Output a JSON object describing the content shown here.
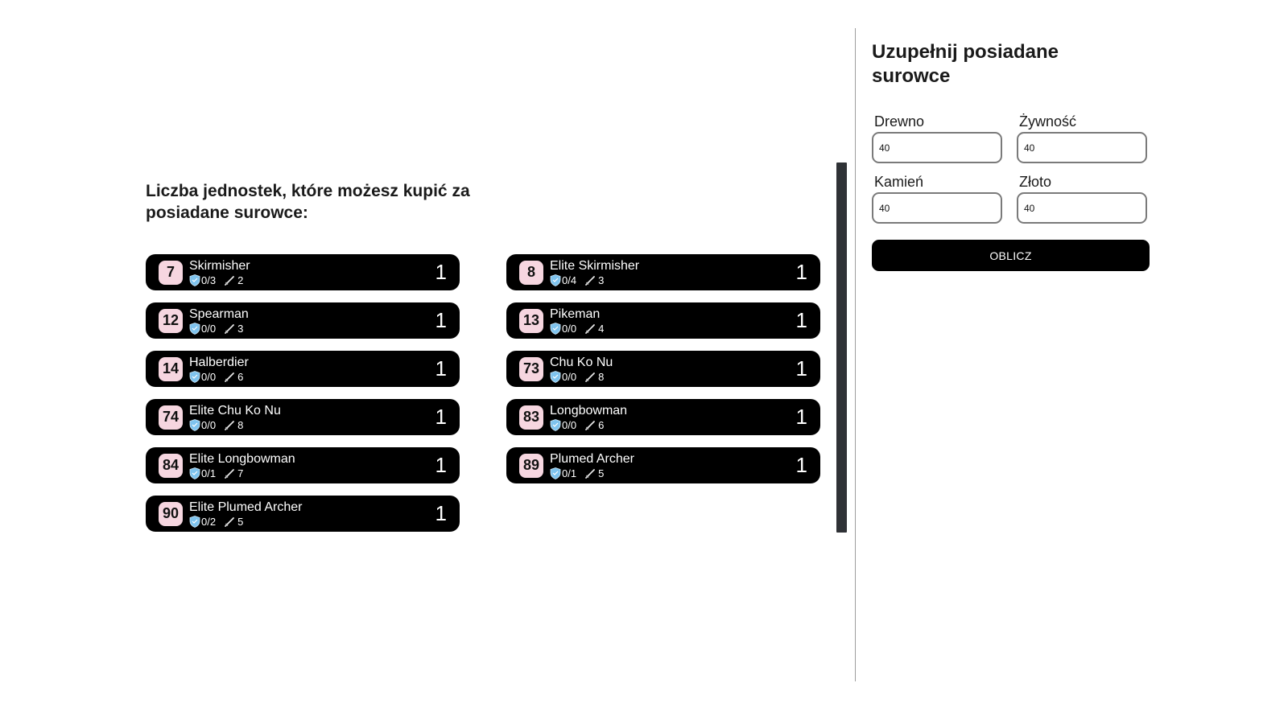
{
  "results": {
    "title": "Liczba jednostek, które możesz kupić za posiadane surowce:",
    "units": [
      {
        "id": "7",
        "name": "Skirmisher",
        "defense": "0/3",
        "attack": "2",
        "count": "1"
      },
      {
        "id": "8",
        "name": "Elite Skirmisher",
        "defense": "0/4",
        "attack": "3",
        "count": "1"
      },
      {
        "id": "12",
        "name": "Spearman",
        "defense": "0/0",
        "attack": "3",
        "count": "1"
      },
      {
        "id": "13",
        "name": "Pikeman",
        "defense": "0/0",
        "attack": "4",
        "count": "1"
      },
      {
        "id": "14",
        "name": "Halberdier",
        "defense": "0/0",
        "attack": "6",
        "count": "1"
      },
      {
        "id": "73",
        "name": "Chu Ko Nu",
        "defense": "0/0",
        "attack": "8",
        "count": "1"
      },
      {
        "id": "74",
        "name": "Elite Chu Ko Nu",
        "defense": "0/0",
        "attack": "8",
        "count": "1"
      },
      {
        "id": "83",
        "name": "Longbowman",
        "defense": "0/0",
        "attack": "6",
        "count": "1"
      },
      {
        "id": "84",
        "name": "Elite Longbowman",
        "defense": "0/1",
        "attack": "7",
        "count": "1"
      },
      {
        "id": "89",
        "name": "Plumed Archer",
        "defense": "0/1",
        "attack": "5",
        "count": "1"
      },
      {
        "id": "90",
        "name": "Elite Plumed Archer",
        "defense": "0/2",
        "attack": "5",
        "count": "1"
      }
    ],
    "icons": {
      "defense": "shield-icon",
      "attack": "sword-icon"
    }
  },
  "form": {
    "title": "Uzupełnij posiadane surowce",
    "fields": {
      "wood": {
        "label": "Drewno",
        "value": "40"
      },
      "food": {
        "label": "Żywność",
        "value": "40"
      },
      "stone": {
        "label": "Kamień",
        "value": "40"
      },
      "gold": {
        "label": "Złoto",
        "value": "40"
      }
    },
    "button_label": "OBLICZ"
  },
  "colors": {
    "card_background": "#000000",
    "id_badge": "#f6d6e0",
    "shield": "#7ec3ee",
    "button": "#000000"
  }
}
